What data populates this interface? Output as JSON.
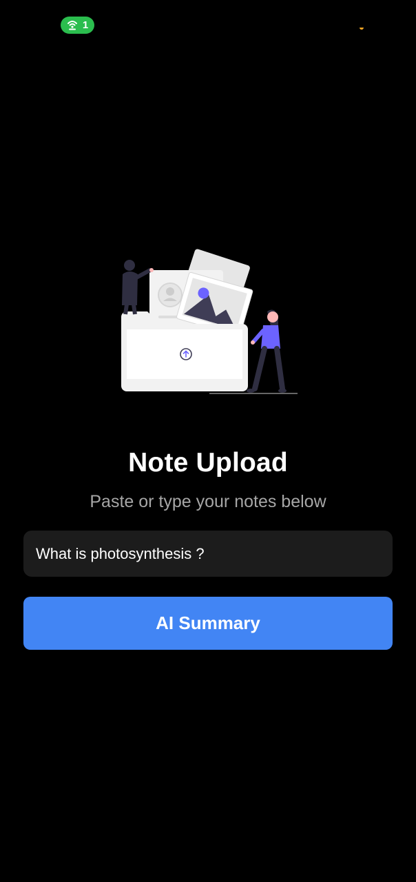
{
  "status_bar": {
    "hotspot_icon": "wifi-hotspot-icon",
    "hotspot_count": "1",
    "pill_color": "#2bbd4e"
  },
  "illustration": {
    "name": "upload-folder-illustration",
    "accent_color": "#6c63ff"
  },
  "main": {
    "title": "Note Upload",
    "subtitle": "Paste or type your notes below",
    "notes_input": {
      "value": "What is photosynthesis ?",
      "placeholder": ""
    },
    "summary_button": {
      "label": "AI Summary",
      "color": "#4285f4"
    }
  }
}
